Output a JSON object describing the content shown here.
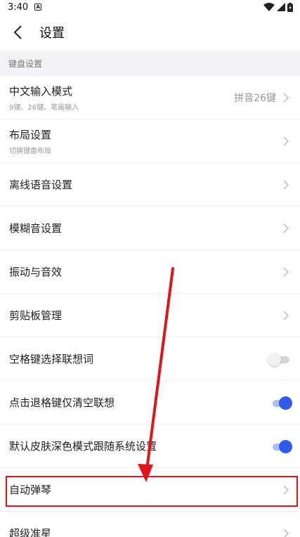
{
  "status": {
    "time": "3:40",
    "notif": "A"
  },
  "header": {
    "title": "设置"
  },
  "section": {
    "label": "键盘设置"
  },
  "rows": [
    {
      "title": "中文输入模式",
      "sub": "9键、26键、笔画输入",
      "value": "拼音26键"
    },
    {
      "title": "布局设置",
      "sub": "切换键盘布局"
    },
    {
      "title": "离线语音设置"
    },
    {
      "title": "模糊音设置"
    },
    {
      "title": "振动与音效"
    },
    {
      "title": "剪贴板管理"
    },
    {
      "title": "空格键选择联想词",
      "toggle": false
    },
    {
      "title": "点击退格键仅清空联想",
      "toggle": true
    },
    {
      "title": "默认皮肤深色模式跟随系统设置",
      "toggle": true
    },
    {
      "title": "自动弹琴"
    },
    {
      "title": "超级准星"
    }
  ],
  "colors": {
    "accent": "#2f5bea",
    "annotation": "#e2141b"
  }
}
